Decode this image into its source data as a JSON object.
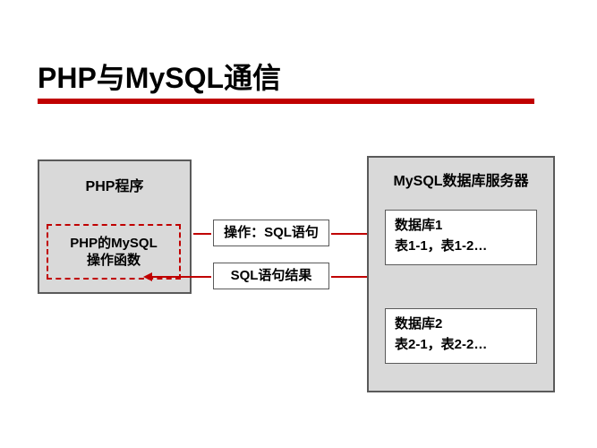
{
  "title": "PHP与MySQL通信",
  "left_box": {
    "title": "PHP程序",
    "inner_line1": "PHP的MySQL",
    "inner_line2": "操作函数"
  },
  "middle": {
    "top_label": "操作：SQL语句",
    "bottom_label": "SQL语句结果"
  },
  "right_box": {
    "title": "MySQL数据库服务器",
    "db1_line1": "数据库1",
    "db1_line2": "表1-1，表1-2…",
    "db2_line1": "数据库2",
    "db2_line2": "表2-1，表2-2…"
  }
}
